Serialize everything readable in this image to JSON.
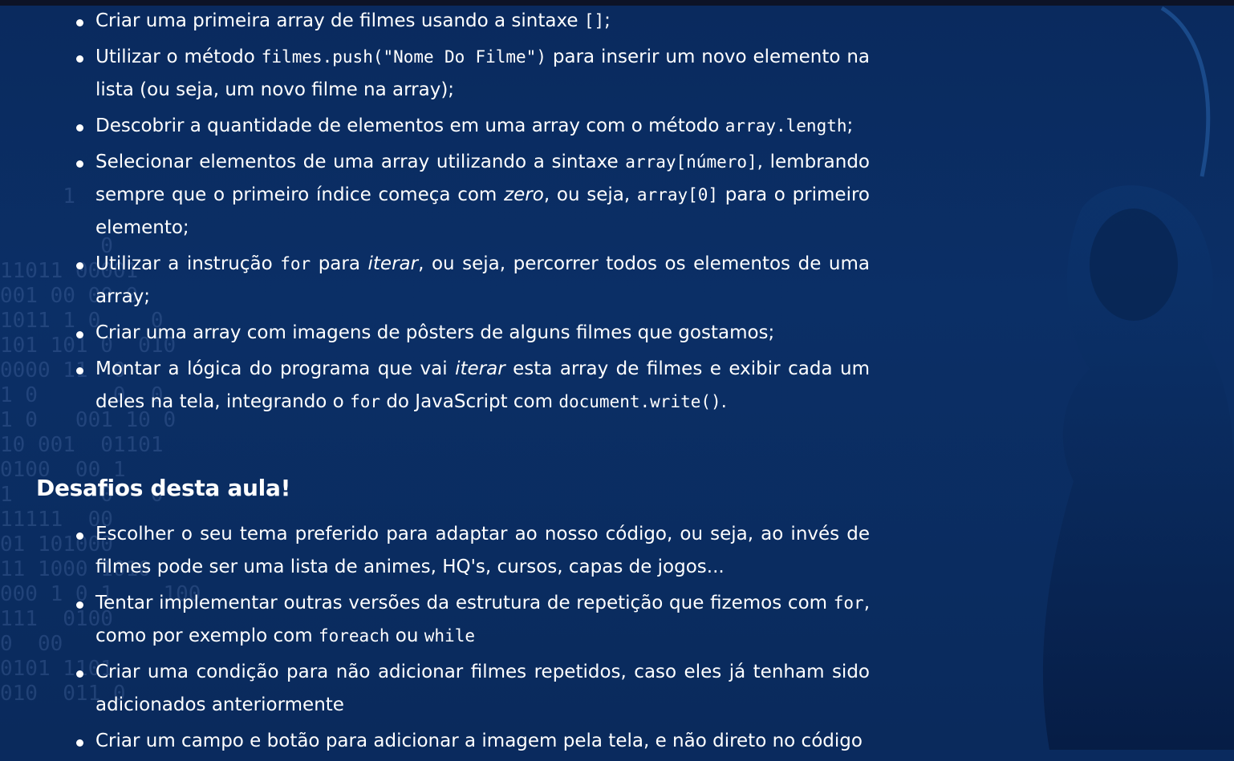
{
  "learned_items": [
    {
      "t1": "Criar uma primeira array de filmes usando a sintaxe ",
      "c1": "[]",
      "t2": ";"
    },
    {
      "t1": "Utilizar o método ",
      "c1": "filmes.push(\"Nome Do Filme\")",
      "t2": " para inserir um novo elemento na lista (ou seja, um novo filme na array);"
    },
    {
      "t1": "Descobrir a quantidade de elementos em uma array com o método ",
      "c1": "array.length",
      "t2": ";"
    },
    {
      "t1": "Selecionar elementos de uma array utilizando a sintaxe ",
      "c1": "array[número]",
      "t2": ", lembrando sempre que o primeiro índice começa com ",
      "e1": "zero",
      "t3": ", ou seja, ",
      "c2": "array[0]",
      "t4": " para o primeiro elemento;"
    },
    {
      "t1": "Utilizar a instrução ",
      "c1": "for",
      "t2": " para ",
      "e1": "iterar",
      "t3": ", ou seja, percorrer todos os elementos de uma array;"
    },
    {
      "t1": "Criar uma array com imagens de pôsters de alguns filmes que gostamos;"
    },
    {
      "t1": "Montar a lógica do programa que vai ",
      "e1": "iterar",
      "t2": " esta array de filmes e exibir cada um deles na tela, integrando o ",
      "c1": "for",
      "t3": " do JavaScript com ",
      "c2": "document.write()",
      "t4": "."
    }
  ],
  "challenges_title": "Desafios desta aula!",
  "challenges": [
    {
      "t1": "Escolher o seu tema preferido para adaptar ao nosso código, ou seja, ao invés de filmes pode ser uma lista de animes, HQ's, cursos, capas de jogos..."
    },
    {
      "t1": "Tentar implementar outras versões da estrutura de repetição que fizemos com ",
      "c1": "for",
      "t2": ", como por exemplo com ",
      "c2": "foreach",
      "t3": " ou ",
      "c3": "while"
    },
    {
      "t1": "Criar uma condição para não adicionar filmes repetidos, caso eles já tenham sido adicionados anteriormente"
    },
    {
      "t1": "Criar um campo e botão para adicionar a imagem pela tela, e não direto no código"
    }
  ]
}
